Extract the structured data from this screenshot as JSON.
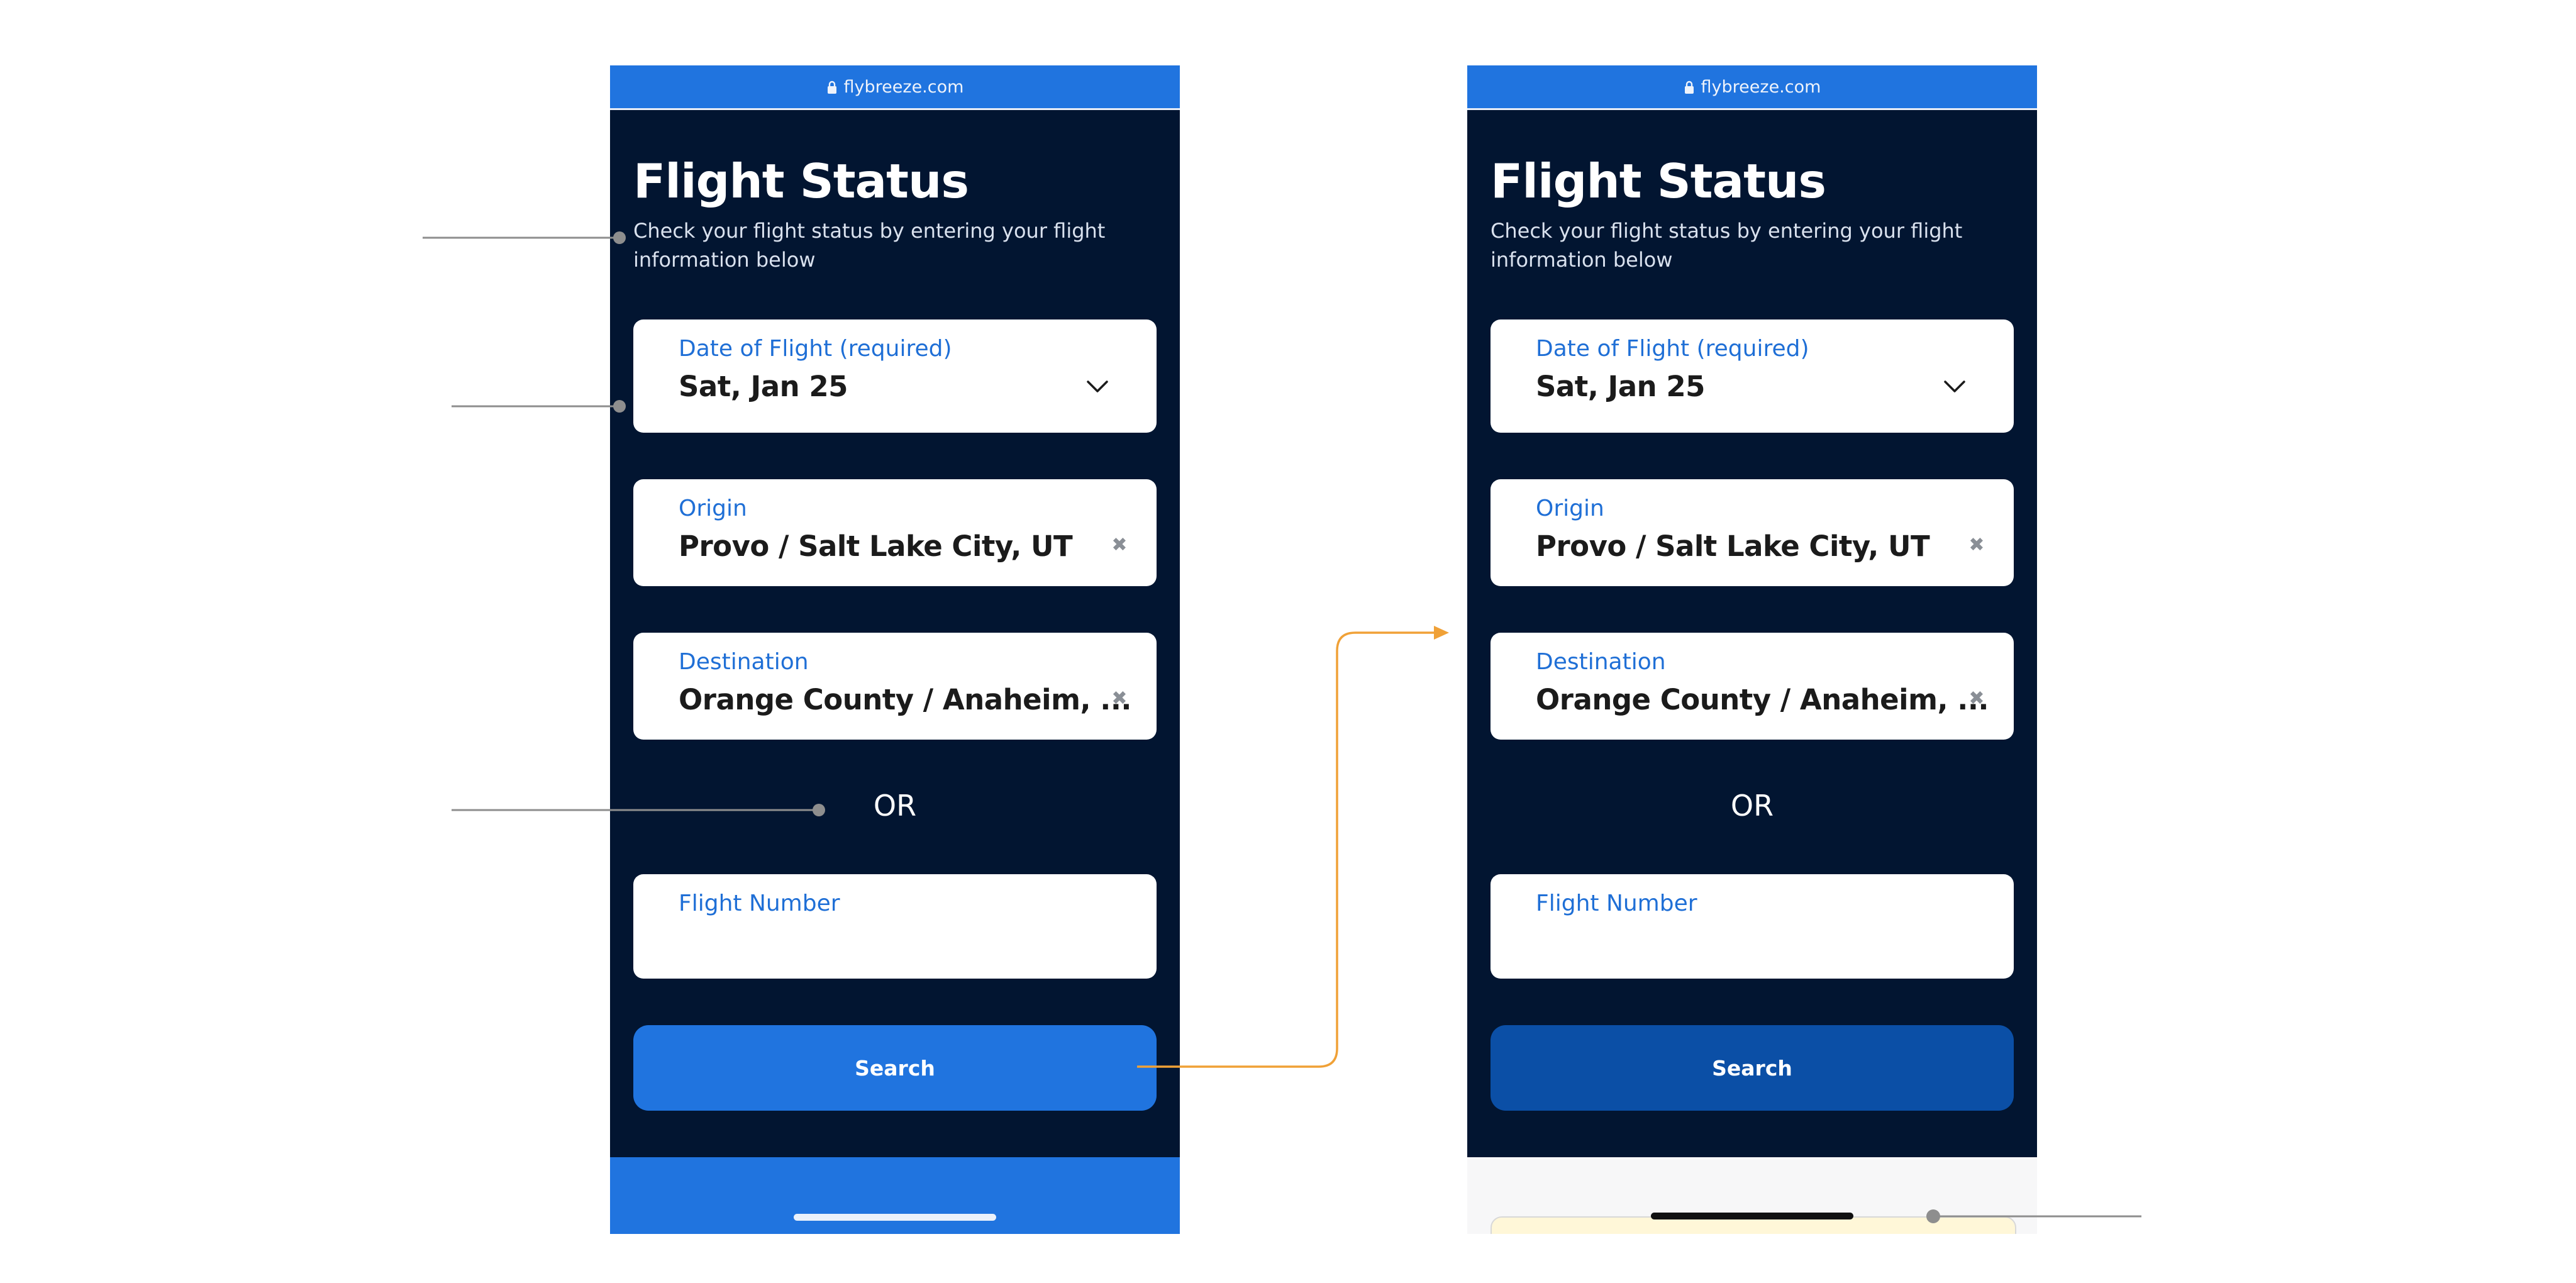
{
  "browser": {
    "url": "flybreeze.com"
  },
  "screens": {
    "left": {
      "title": "Flight Status",
      "subtitle": "Check your flight status by entering your flight information below",
      "date_field": {
        "label": "Date of Flight (required)",
        "value": "Sat, Jan 25"
      },
      "origin_field": {
        "label": "Origin",
        "value": "Provo / Salt Lake City, UT"
      },
      "destination_field": {
        "label": "Destination",
        "value": "Orange County / Anaheim, ..."
      },
      "or_text": "OR",
      "flight_number_field": {
        "label": "Flight Number",
        "value": ""
      },
      "search_button": "Search"
    },
    "right": {
      "title": "Flight Status",
      "subtitle": "Check your flight status by entering your flight information below",
      "date_field": {
        "label": "Date of Flight (required)",
        "value": "Sat, Jan 25"
      },
      "origin_field": {
        "label": "Origin",
        "value": "Provo / Salt Lake City, UT"
      },
      "destination_field": {
        "label": "Destination",
        "value": "Orange County / Anaheim, ..."
      },
      "or_text": "OR",
      "flight_number_field": {
        "label": "Flight Number",
        "value": ""
      },
      "search_button": "Search"
    }
  },
  "colors": {
    "page_bg": "#021531",
    "accent_blue": "#2074df",
    "pressed_blue": "#0b4fa6",
    "label_blue": "#1f6fd6",
    "annotation_orange": "#f0a137",
    "annotation_gray": "#8e8e8e"
  },
  "icons": {
    "lock": "lock-icon",
    "chevron": "chevron-down-icon",
    "clear": "clear-icon"
  }
}
